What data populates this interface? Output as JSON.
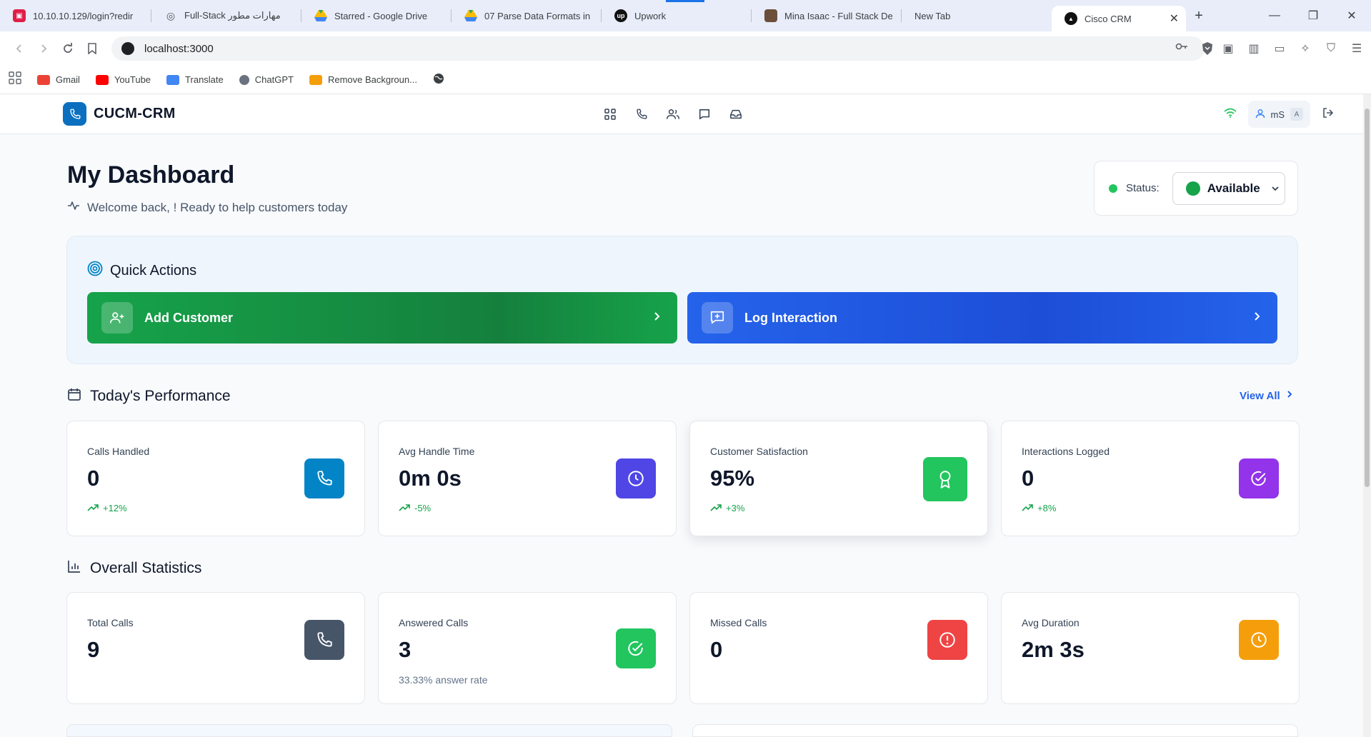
{
  "browser": {
    "tabs": [
      {
        "title": "10.10.10.129/login?redir",
        "color": "#e11d48",
        "glyph": "F"
      },
      {
        "title": "",
        "color": "#6b7280",
        "glyph": "◎"
      },
      {
        "title": "Full-Stack مهارات مطور",
        "color": "#9ca3af",
        "glyph": ""
      },
      {
        "title": "Starred - Google Drive",
        "color": "#34a853",
        "glyph": "▲"
      },
      {
        "title": "07 Parse Data Formats in",
        "color": "#34a853",
        "glyph": "▲"
      },
      {
        "title": "Upwork",
        "color": "#111111",
        "glyph": "up"
      },
      {
        "title": "Mina Isaac - Full Stack De",
        "color": "#6b4f3a",
        "glyph": ""
      },
      {
        "title": "New Tab",
        "color": "",
        "glyph": ""
      },
      {
        "title": "Cisco CRM",
        "color": "#111111",
        "glyph": "▲"
      }
    ],
    "url": "localhost:3000",
    "bookmarks": [
      {
        "label": "Gmail",
        "color": "#ea4335"
      },
      {
        "label": "YouTube",
        "color": "#ff0000"
      },
      {
        "label": "Translate",
        "color": "#4285f4"
      },
      {
        "label": "ChatGPT",
        "color": "#6b7280"
      },
      {
        "label": "Remove Backgroun...",
        "color": "#f59e0b"
      }
    ]
  },
  "app": {
    "brand": "CUCM-CRM",
    "user_initials": "mS",
    "user_key": "A"
  },
  "header": {
    "title": "My Dashboard",
    "welcome": "Welcome back, ! Ready to help customers today",
    "status_label": "Status:",
    "status_value": "Available"
  },
  "quick_actions": {
    "title": "Quick Actions",
    "add_customer": "Add Customer",
    "log_interaction": "Log Interaction"
  },
  "performance": {
    "title": "Today's Performance",
    "view_all": "View All",
    "cards": [
      {
        "label": "Calls Handled",
        "value": "0",
        "trend": "+12%",
        "icon": "phone-icon",
        "color": "#0284c7"
      },
      {
        "label": "Avg Handle Time",
        "value": "0m 0s",
        "trend": "-5%",
        "icon": "clock-icon",
        "color": "#4f46e5"
      },
      {
        "label": "Customer Satisfaction",
        "value": "95%",
        "trend": "+3%",
        "icon": "award-icon",
        "color": "#22c55e"
      },
      {
        "label": "Interactions Logged",
        "value": "0",
        "trend": "+8%",
        "icon": "check-circle-icon",
        "color": "#9333ea"
      }
    ]
  },
  "overall": {
    "title": "Overall Statistics",
    "cards": [
      {
        "label": "Total Calls",
        "value": "9",
        "sub": "",
        "icon": "phone-icon",
        "color": "#475569"
      },
      {
        "label": "Answered Calls",
        "value": "3",
        "sub": "33.33% answer rate",
        "icon": "check-circle-icon",
        "color": "#22c55e"
      },
      {
        "label": "Missed Calls",
        "value": "0",
        "sub": "",
        "icon": "alert-circle-icon",
        "color": "#ef4444"
      },
      {
        "label": "Avg Duration",
        "value": "2m 3s",
        "sub": "",
        "icon": "clock-icon",
        "color": "#f59e0b"
      }
    ]
  }
}
